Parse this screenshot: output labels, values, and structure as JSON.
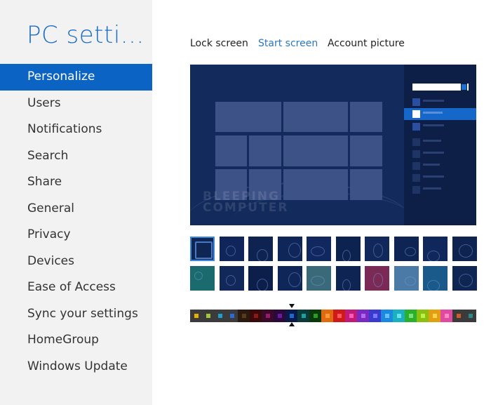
{
  "sidebar": {
    "title": "PC setti...",
    "items": [
      {
        "label": "Personalize",
        "active": true
      },
      {
        "label": "Users"
      },
      {
        "label": "Notifications"
      },
      {
        "label": "Search"
      },
      {
        "label": "Share"
      },
      {
        "label": "General"
      },
      {
        "label": "Privacy"
      },
      {
        "label": "Devices"
      },
      {
        "label": "Ease of Access"
      },
      {
        "label": "Sync your settings"
      },
      {
        "label": "HomeGroup"
      },
      {
        "label": "Windows Update"
      }
    ]
  },
  "tabs": [
    {
      "label": "Lock screen"
    },
    {
      "label": "Start screen",
      "active": true
    },
    {
      "label": "Account picture"
    }
  ],
  "preview": {
    "watermark_line1": "BLEEPING",
    "watermark_line2": "COMPUTER"
  },
  "backgrounds": {
    "selected_index": 0,
    "row1": [
      "#0f2552",
      "#10265a",
      "#0e2350",
      "#0f2658",
      "#10285e",
      "#0d234f",
      "#10285a",
      "#0e2452",
      "#0f275a",
      "#0e2350"
    ],
    "row2": [
      "#1a6a6e",
      "#12285a",
      "#0c1f4b",
      "#0f2658",
      "#3a6a7a",
      "#0e2452",
      "#7a2a55",
      "#4a7aa5",
      "#1a5a8a",
      "#0f2552"
    ]
  },
  "colors": {
    "selected_index": 8,
    "swatches": [
      {
        "bg": "#3b3b3b",
        "chip": "#e8b000"
      },
      {
        "bg": "#3b3b3b",
        "chip": "#9fc83c"
      },
      {
        "bg": "#3b3b3b",
        "chip": "#1aa0d0"
      },
      {
        "bg": "#3b3b3b",
        "chip": "#2a6ad8"
      },
      {
        "bg": "#2a1a10",
        "chip": "#5a3a1a"
      },
      {
        "bg": "#3a0a0a",
        "chip": "#8a1a1a"
      },
      {
        "bg": "#3a0a2a",
        "chip": "#9a1a6a"
      },
      {
        "bg": "#2a0a3a",
        "chip": "#6a1aa0"
      },
      {
        "bg": "#0a1a4a",
        "chip": "#1a6ad0"
      },
      {
        "bg": "#0a3a3a",
        "chip": "#1aa0a0"
      },
      {
        "bg": "#0a3a0a",
        "chip": "#2a9a2a"
      },
      {
        "bg": "#e06a10",
        "chip": "#ff9a3a"
      },
      {
        "bg": "#d01a1a",
        "chip": "#ff5a5a"
      },
      {
        "bg": "#c01a7a",
        "chip": "#ff5ab0"
      },
      {
        "bg": "#7a2ac0",
        "chip": "#b06af0"
      },
      {
        "bg": "#3a3ad0",
        "chip": "#7a7aff"
      },
      {
        "bg": "#1a8ae0",
        "chip": "#6ac0ff"
      },
      {
        "bg": "#1ab0c0",
        "chip": "#6ae0f0"
      },
      {
        "bg": "#2ab02a",
        "chip": "#7ae07a"
      },
      {
        "bg": "#8ac010",
        "chip": "#c0f04a"
      },
      {
        "bg": "#e0a010",
        "chip": "#ffd050"
      },
      {
        "bg": "#e04aa0",
        "chip": "#ff8ac8"
      },
      {
        "bg": "#3b3b3b",
        "chip": "#d05a2a"
      },
      {
        "bg": "#3b3b3b",
        "chip": "#2a8a8a"
      }
    ]
  }
}
